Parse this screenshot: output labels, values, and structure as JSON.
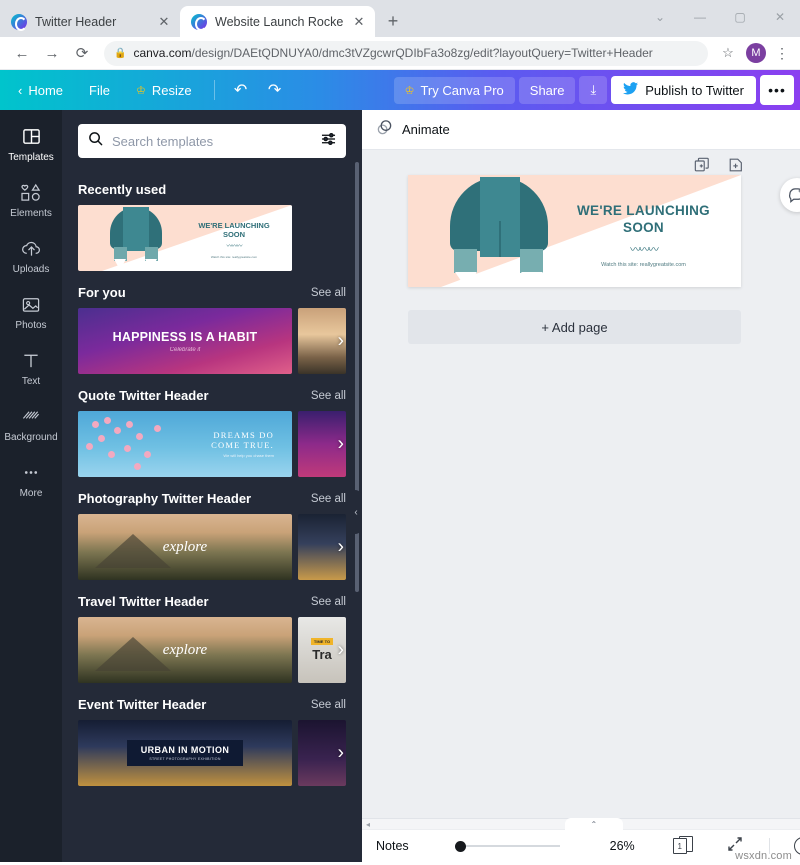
{
  "browser": {
    "tabs": [
      {
        "title": "Twitter Header",
        "active": false
      },
      {
        "title": "Website Launch Rocketship Twitt",
        "active": true
      }
    ],
    "new_tab_label": "+",
    "window_controls": [
      "⌄",
      "—",
      "▢",
      "✕"
    ],
    "nav": {
      "back": "←",
      "forward": "→",
      "reload": "⟳"
    },
    "url_domain": "canva.com",
    "url_rest": "/design/DAEtQDNUYA0/dmc3tVZgcwrQDIbFa3o8zg/edit?layoutQuery=Twitter+Header",
    "lock_icon": "🔒",
    "star_icon": "☆",
    "avatar_letter": "M",
    "menu_icon": "⋮"
  },
  "canva_toolbar": {
    "back_chevron": "‹",
    "home": "Home",
    "file": "File",
    "resize": "Resize",
    "resize_crown": "♔",
    "undo": "↶",
    "redo": "↷",
    "try_pro": "Try Canva Pro",
    "try_pro_crown": "♔",
    "share": "Share",
    "download_icon": "⤓",
    "publish": "Publish to Twitter",
    "publish_bird": "🐦",
    "more": "•••"
  },
  "rail": {
    "items": [
      {
        "label": "Templates",
        "icon": "templates-icon",
        "active": true
      },
      {
        "label": "Elements",
        "icon": "elements-icon",
        "active": false
      },
      {
        "label": "Uploads",
        "icon": "uploads-icon",
        "active": false
      },
      {
        "label": "Photos",
        "icon": "photos-icon",
        "active": false
      },
      {
        "label": "Text",
        "icon": "text-icon",
        "active": false
      },
      {
        "label": "Background",
        "icon": "background-icon",
        "active": false
      },
      {
        "label": "More",
        "icon": "more-icon",
        "active": false
      }
    ]
  },
  "panel": {
    "search_placeholder": "Search templates",
    "search_value": "",
    "search_icon": "search-icon",
    "filter_icon": "filter-icon",
    "see_all": "See all",
    "arrow": "›",
    "collapse_chevron": "‹",
    "sections": [
      {
        "title": "Recently used",
        "has_see_all": false
      },
      {
        "title": "For you",
        "has_see_all": true
      },
      {
        "title": "Quote Twitter Header",
        "has_see_all": true
      },
      {
        "title": "Photography Twitter Header",
        "has_see_all": true
      },
      {
        "title": "Travel Twitter Header",
        "has_see_all": true
      },
      {
        "title": "Event Twitter Header",
        "has_see_all": true
      }
    ],
    "thumbs": {
      "rocket_line1": "WE'RE LAUNCHING",
      "rocket_line2": "SOON",
      "rocket_sub": "Watch this site: reallygreatsite.com",
      "happiness_title": "HAPPINESS IS A HABIT",
      "happiness_sub": "Celebrate it",
      "dreams_line1": "DREAMS DO",
      "dreams_line2": "COME TRUE.",
      "dreams_sub": "We will help you chase them",
      "explore_word": "explore",
      "travel_tag": "TIME TO",
      "travel_word": "Tra",
      "event_title": "URBAN IN MOTION",
      "event_sub": "STREET PHOTOGRAPHY EXHIBITION"
    }
  },
  "editor": {
    "animate_label": "Animate",
    "animate_icon": "animate-icon",
    "duplicate_page_icon": "duplicate-page-icon",
    "add_page_icon": "add-page-icon",
    "comment_icon": "add-comment-icon",
    "add_page_label": "+ Add page",
    "design": {
      "line1": "WE'RE LAUNCHING",
      "line2": "SOON",
      "wave": "〰〰〰",
      "subtitle": "Watch this site: reallygreatsite.com"
    }
  },
  "bottom": {
    "notes": "Notes",
    "zoom_percent": "26%",
    "page_number": "1",
    "pages_icon": "pages-icon",
    "expand_icon": "expand-icon",
    "help_icon": "?",
    "scroll_left": "◂",
    "scroll_right": "▸",
    "collapse_caret": "⌃",
    "watermark": "wsxdn.com"
  }
}
